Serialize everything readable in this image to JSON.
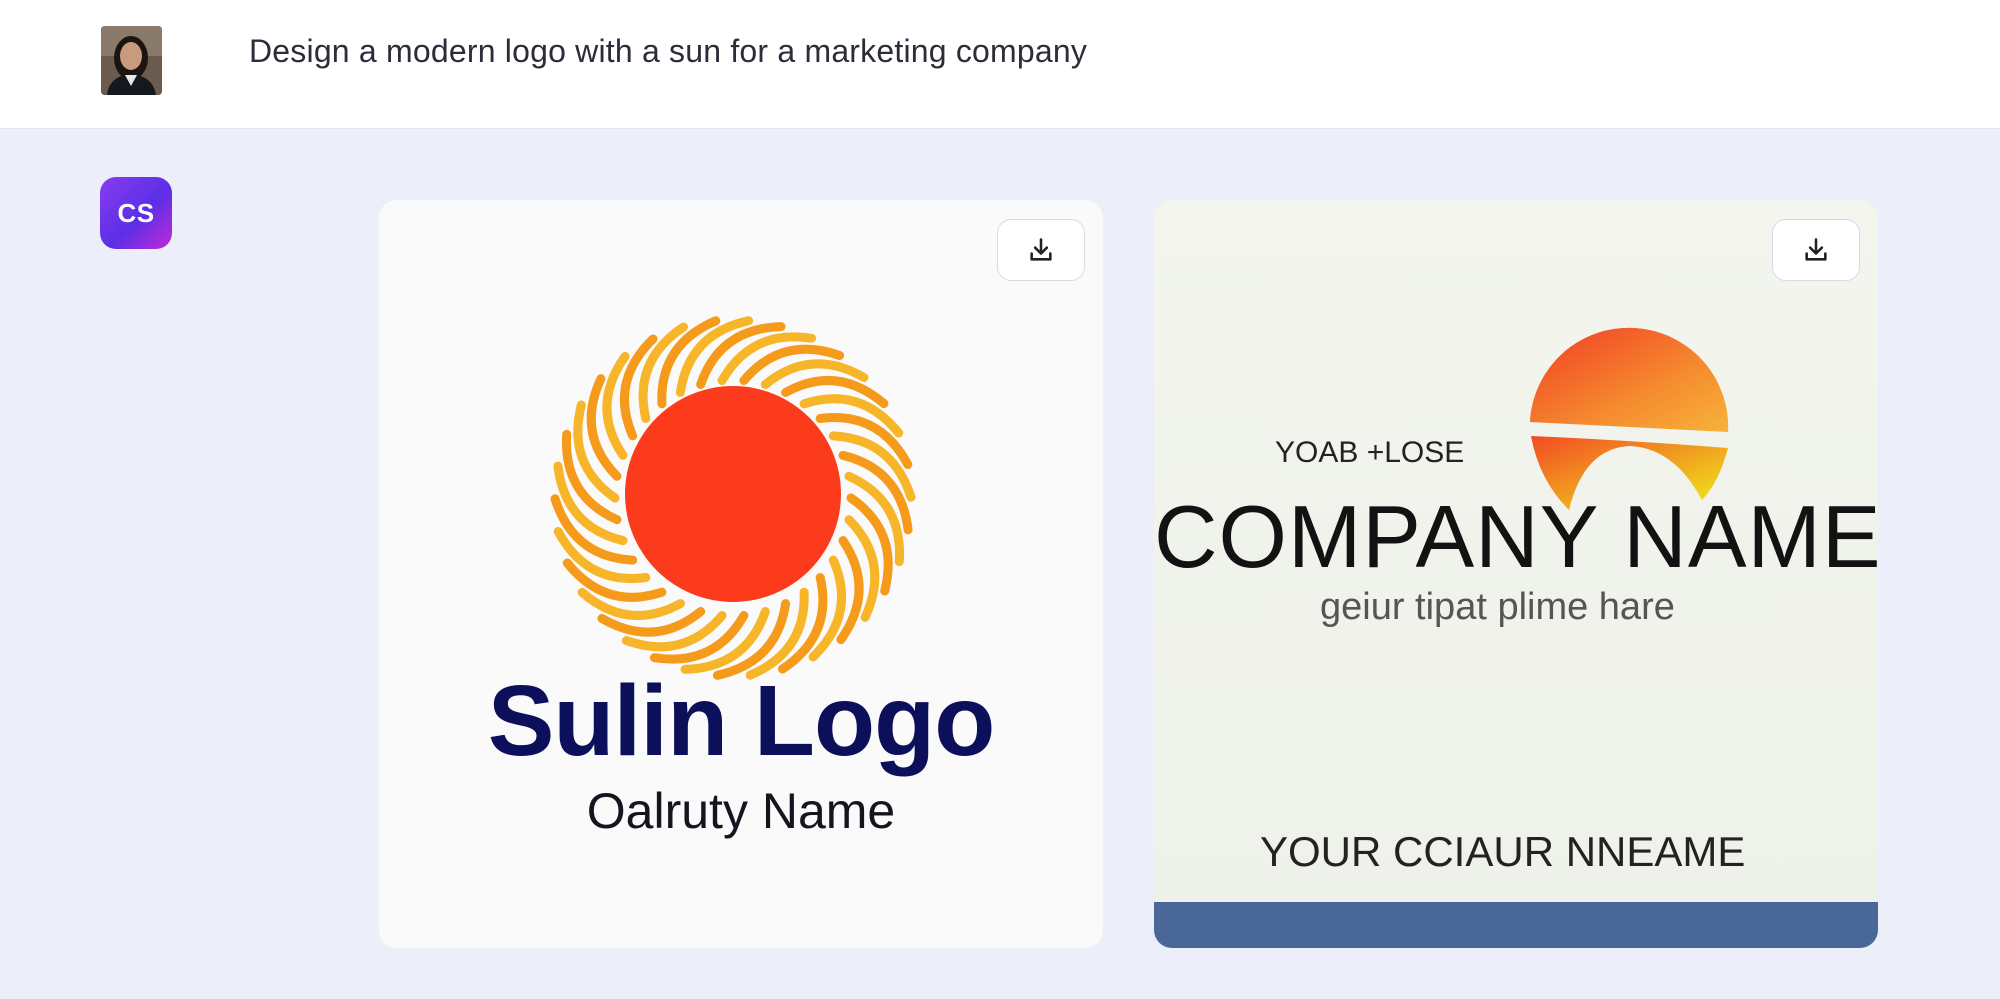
{
  "prompt": {
    "text": "Design a modern logo with a sun for a marketing company"
  },
  "user_avatar_icon": "user-photo",
  "assistant": {
    "avatar_label": "CS"
  },
  "download_icon": "download-icon",
  "images": [
    {
      "title": "Sulin Logo",
      "subtitle": "Oalruty Name",
      "colors": {
        "sun": "#fc3a1c",
        "rays": "#f9a825",
        "title": "#0c0f59"
      }
    },
    {
      "small_text": "YOAB +LOSE",
      "title": "COMPANY NAME",
      "tagline": "geiur tipat plime hare",
      "bottom_text": "YOUR CCIAUR NNEAME",
      "colors": {
        "sun_top": "#f4582a",
        "sun_bottom": "#f5e51a",
        "bar": "#4a6897"
      }
    }
  ]
}
